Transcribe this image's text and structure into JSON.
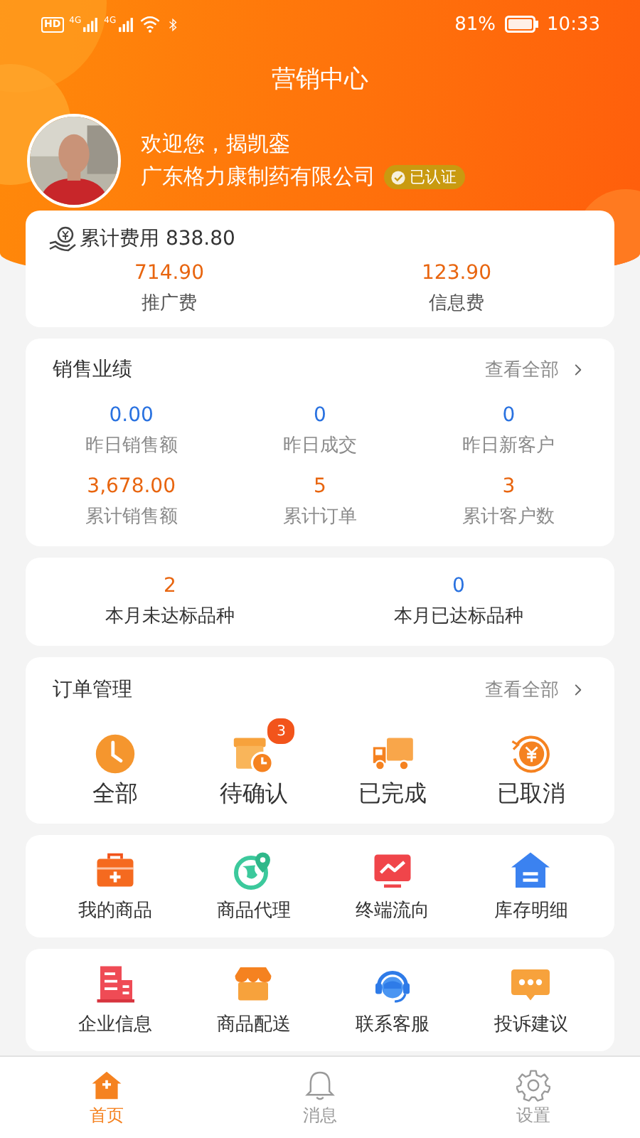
{
  "status_bar": {
    "hd": "HD",
    "signals": [
      "4G",
      "4G"
    ],
    "battery": "81%",
    "time": "10:33"
  },
  "title": "营销中心",
  "profile": {
    "greeting": "欢迎您，揭凯銮",
    "company": "广东格力康制药有限公司",
    "verified": "已认证"
  },
  "fees": {
    "label": "累计费用 838.80",
    "items": [
      {
        "value": "714.90",
        "label": "推广费"
      },
      {
        "value": "123.90",
        "label": "信息费"
      }
    ]
  },
  "sales": {
    "title": "销售业绩",
    "more": "查看全部",
    "stats": [
      {
        "value": "0.00",
        "label": "昨日销售额",
        "color": "#2a72e0"
      },
      {
        "value": "0",
        "label": "昨日成交",
        "color": "#2a72e0"
      },
      {
        "value": "0",
        "label": "昨日新客户",
        "color": "#2a72e0"
      },
      {
        "value": "3,678.00",
        "label": "累计销售额",
        "color": "#e8650f"
      },
      {
        "value": "5",
        "label": "累计订单",
        "color": "#e8650f"
      },
      {
        "value": "3",
        "label": "累计客户数",
        "color": "#e8650f"
      }
    ]
  },
  "monthly": [
    {
      "value": "2",
      "label": "本月未达标品种",
      "color": "#e8650f"
    },
    {
      "value": "0",
      "label": "本月已达标品种",
      "color": "#2a72e0"
    }
  ],
  "orders": {
    "title": "订单管理",
    "more": "查看全部",
    "items": [
      {
        "label": "全部"
      },
      {
        "label": "待确认",
        "badge": "3"
      },
      {
        "label": "已完成"
      },
      {
        "label": "已取消"
      }
    ]
  },
  "tool_rows": [
    {
      "items": [
        {
          "label": "我的商品"
        },
        {
          "label": "商品代理"
        },
        {
          "label": "终端流向"
        },
        {
          "label": "库存明细"
        }
      ]
    },
    {
      "items": [
        {
          "label": "企业信息"
        },
        {
          "label": "商品配送"
        },
        {
          "label": "联系客服"
        },
        {
          "label": "投诉建议"
        }
      ]
    }
  ],
  "nav": [
    {
      "label": "首页",
      "selected": true
    },
    {
      "label": "消息",
      "selected": false
    },
    {
      "label": "设置",
      "selected": false
    }
  ]
}
